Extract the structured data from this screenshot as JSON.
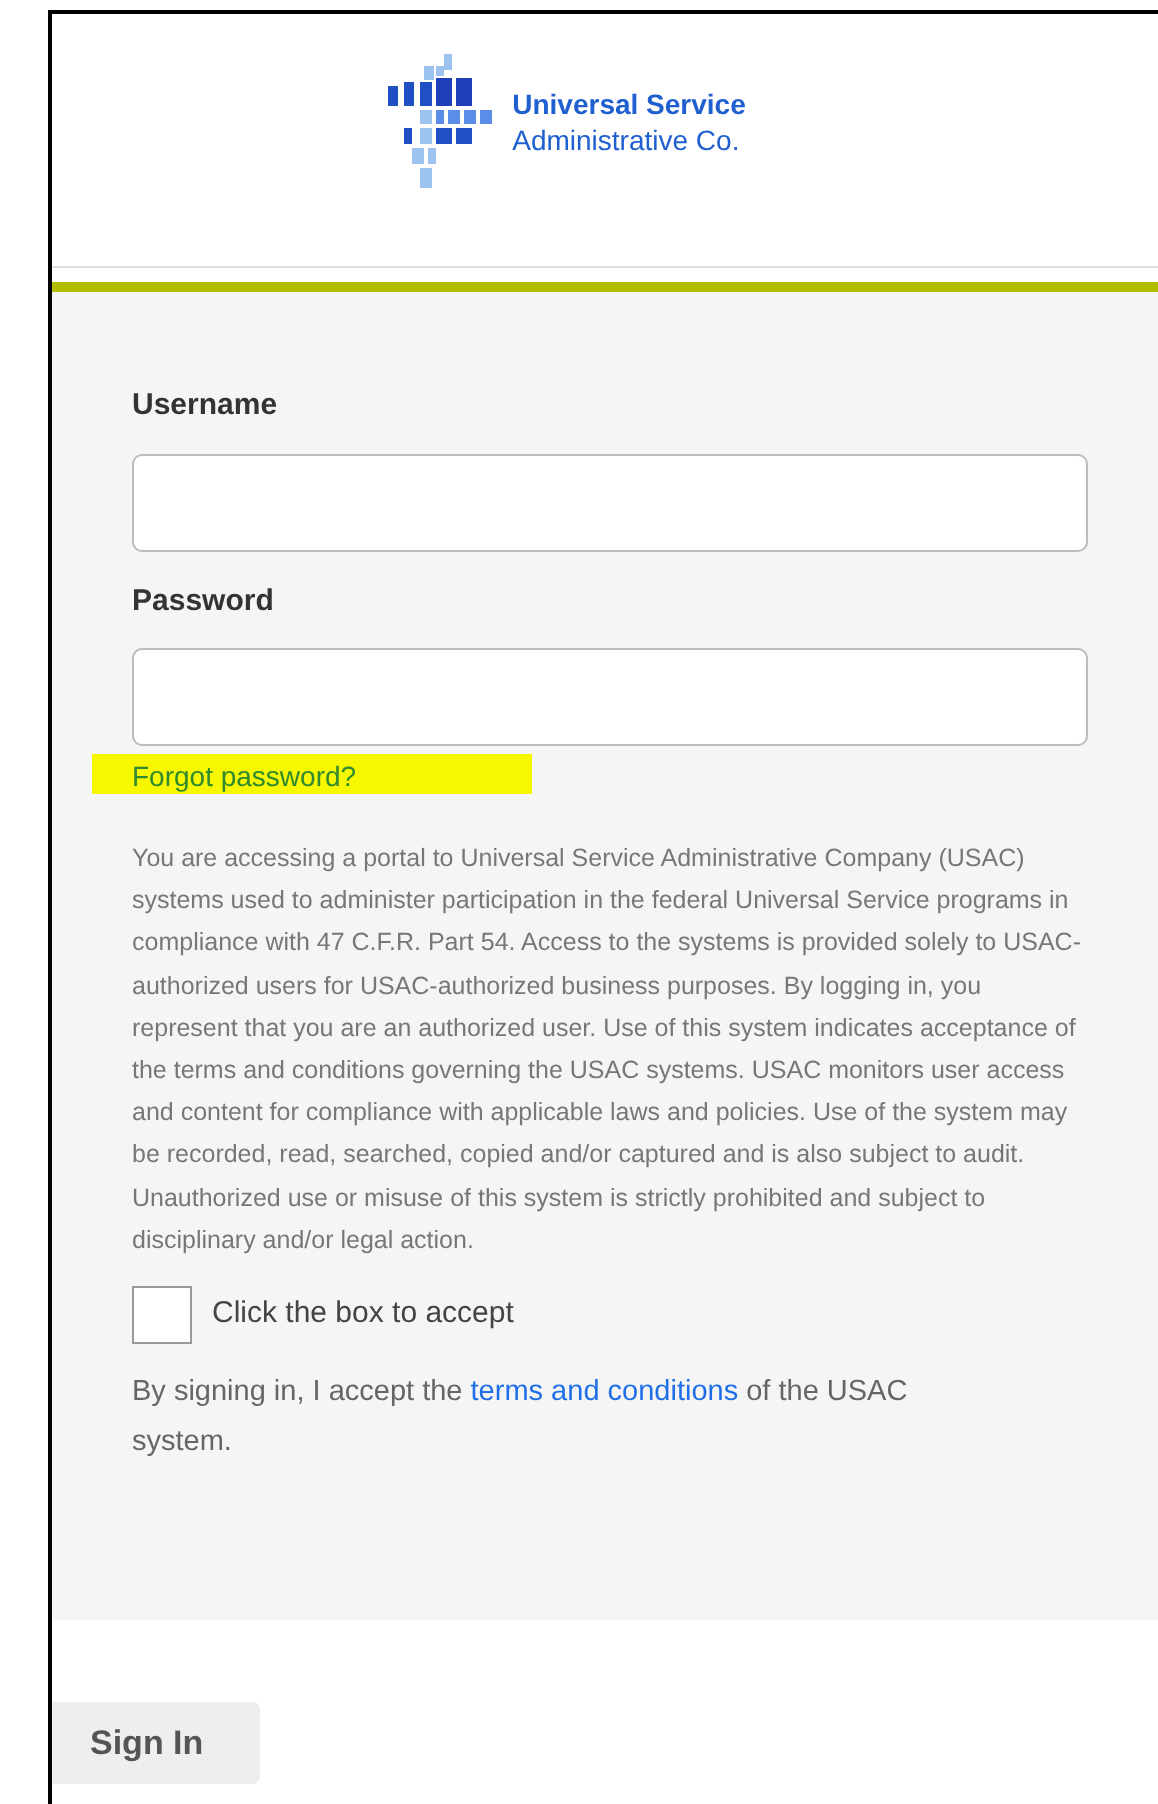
{
  "logo": {
    "line_1": "Universal Service",
    "line_2": "Administrative Co."
  },
  "form": {
    "username_label": "Username",
    "password_label": "Password",
    "forgot_link": {
      "text": "Forgot password?",
      "highlighted": true
    },
    "notice": "You are accessing a portal to Universal Service Administrative Company (USAC) systems used to administer participation in the federal Universal Service programs in compliance with 47 C.F.R. Part 54. Access to the systems is provided solely to USAC-authorized users for USAC-authorized business purposes. By logging in, you represent that you are an authorized user. Use of this system indicates acceptance of the terms and conditions governing the USAC systems. USAC monitors user access and content for compliance with applicable laws and policies. Use of the system may be recorded, read, searched, copied and/or captured and is also subject to audit. Unauthorized use or misuse of this system is strictly prohibited and subject to disciplinary and/or legal action.",
    "accept": {
      "label": "Click the box to accept",
      "checked": false
    },
    "terms": {
      "before": "By signing in, I accept the",
      "link": "terms and conditions",
      "after": "of the USAC system."
    }
  },
  "sign_in_button": "Sign In"
}
